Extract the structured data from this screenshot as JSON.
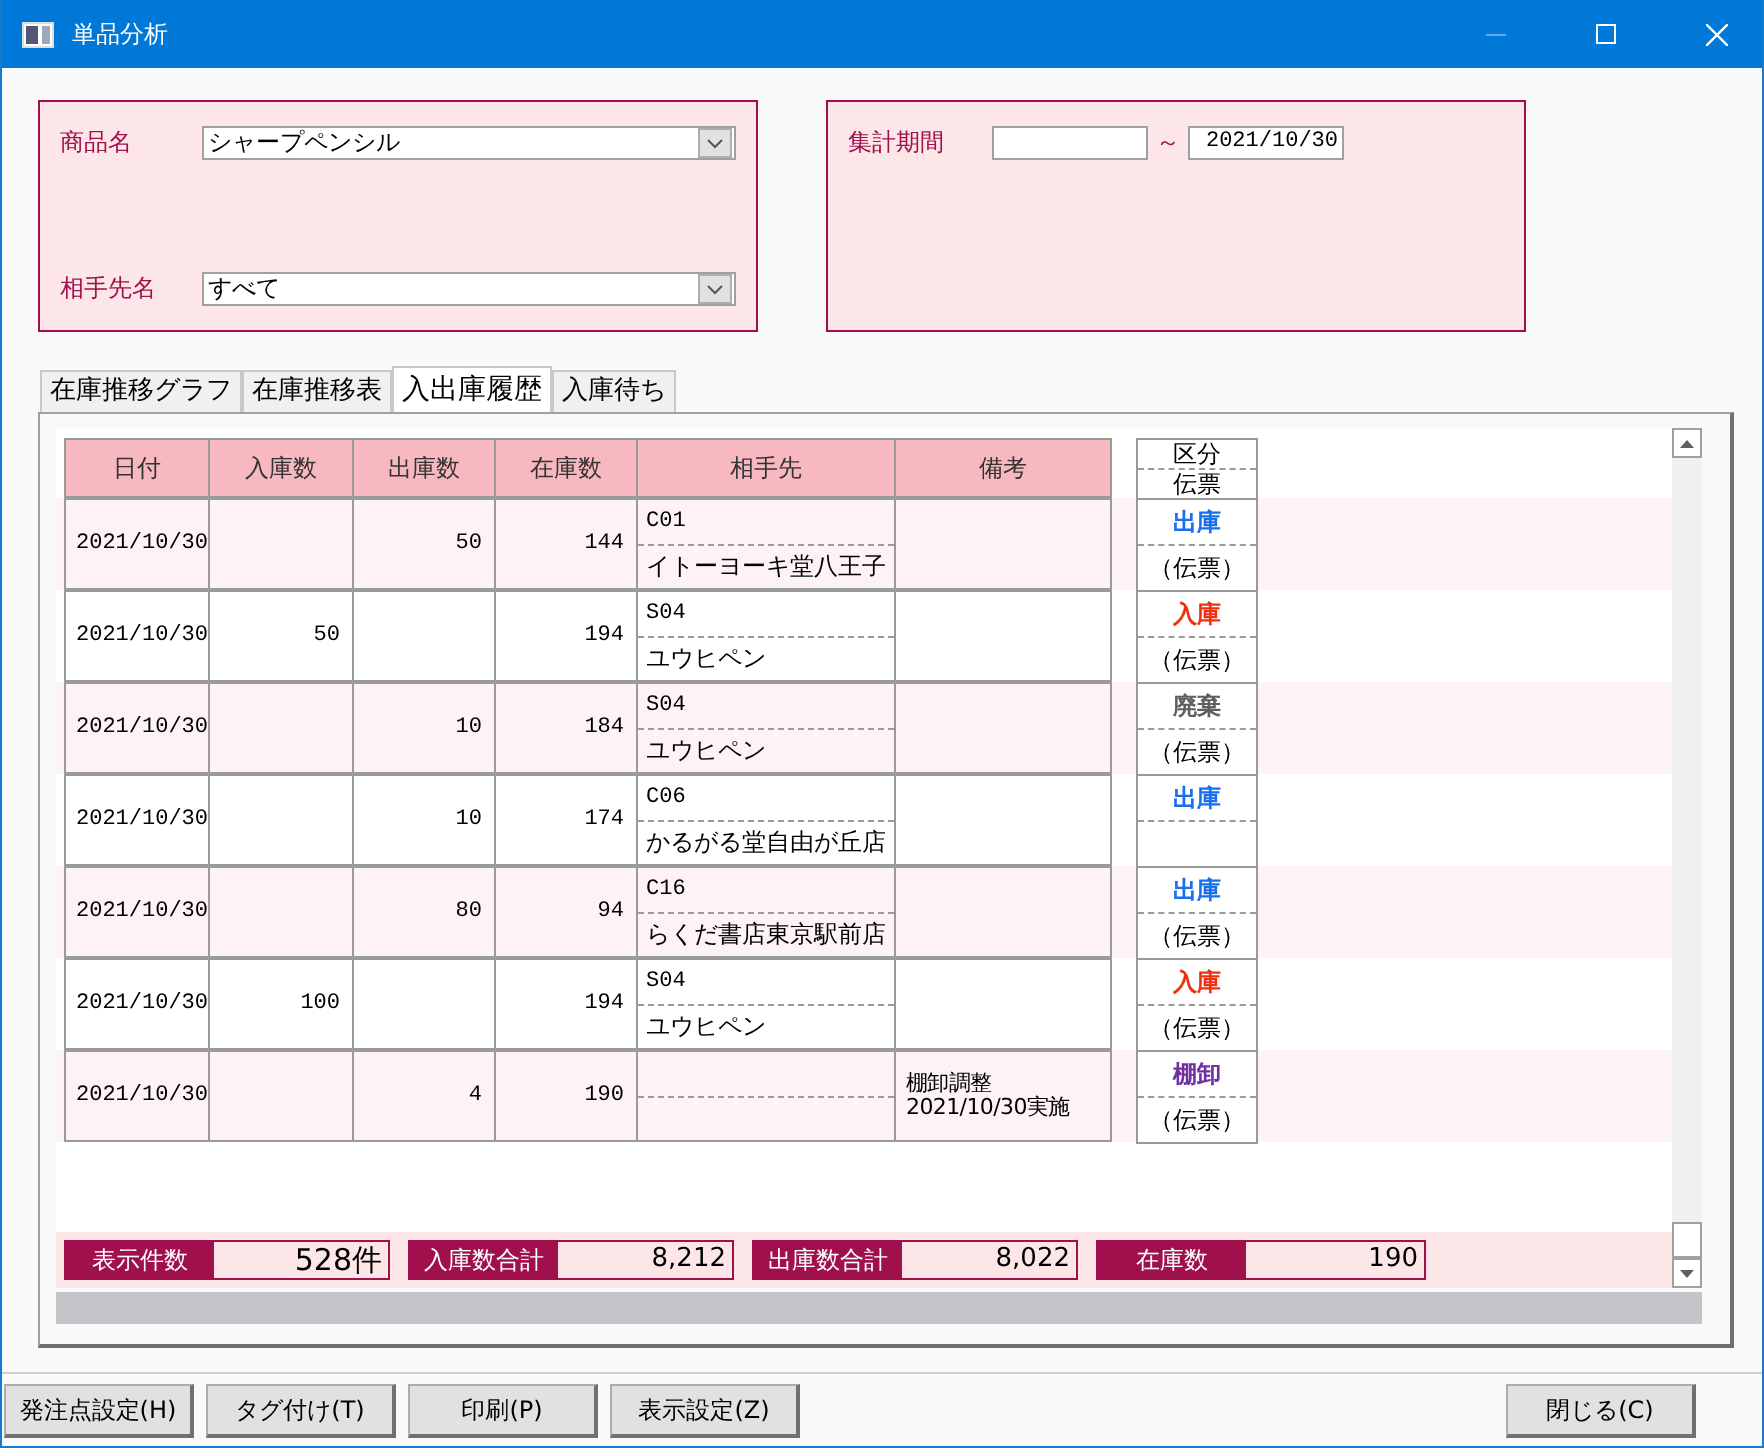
{
  "window": {
    "title": "単品分析"
  },
  "filters": {
    "product": {
      "label": "商品名",
      "value": "シャープペンシル"
    },
    "partner": {
      "label": "相手先名",
      "value": "すべて"
    },
    "period": {
      "label": "集計期間",
      "separator": "～",
      "to": "2021/10/30"
    }
  },
  "tabs": [
    {
      "label": "在庫推移グラフ",
      "selected": false
    },
    {
      "label": "在庫推移表",
      "selected": false
    },
    {
      "label": "入出庫履歴",
      "selected": true
    },
    {
      "label": "入庫待ち",
      "selected": false
    }
  ],
  "table": {
    "columns": [
      "日付",
      "入庫数",
      "出庫数",
      "在庫数",
      "相手先",
      "備考"
    ],
    "side_header": [
      "区分",
      "伝票"
    ],
    "rows": [
      {
        "date": "2021/10/30",
        "in": "",
        "out": "50",
        "stock": "144",
        "partner_code": "C01",
        "partner_name": "イトーヨーキ堂八王子",
        "note": "",
        "category": "出庫",
        "color": "#1a6ff0",
        "slip": "（伝票）"
      },
      {
        "date": "2021/10/30",
        "in": "50",
        "out": "",
        "stock": "194",
        "partner_code": "S04",
        "partner_name": "ユウヒペン",
        "note": "",
        "category": "入庫",
        "color": "#f03010",
        "slip": "（伝票）"
      },
      {
        "date": "2021/10/30",
        "in": "",
        "out": "10",
        "stock": "184",
        "partner_code": "S04",
        "partner_name": "ユウヒペン",
        "note": "",
        "category": "廃棄",
        "color": "#606060",
        "slip": "（伝票）"
      },
      {
        "date": "2021/10/30",
        "in": "",
        "out": "10",
        "stock": "174",
        "partner_code": "C06",
        "partner_name": "かるがる堂自由が丘店",
        "note": "",
        "category": "出庫",
        "color": "#1a6ff0",
        "slip": ""
      },
      {
        "date": "2021/10/30",
        "in": "",
        "out": "80",
        "stock": "94",
        "partner_code": "C16",
        "partner_name": "らくだ書店東京駅前店",
        "note": "",
        "category": "出庫",
        "color": "#1a6ff0",
        "slip": "（伝票）"
      },
      {
        "date": "2021/10/30",
        "in": "100",
        "out": "",
        "stock": "194",
        "partner_code": "S04",
        "partner_name": "ユウヒペン",
        "note": "",
        "category": "入庫",
        "color": "#f03010",
        "slip": "（伝票）"
      },
      {
        "date": "2021/10/30",
        "in": "",
        "out": "4",
        "stock": "190",
        "partner_code": "",
        "partner_name": "",
        "note": "棚卸調整\n2021/10/30実施",
        "category": "棚卸",
        "color": "#7030a0",
        "slip": "（伝票）"
      }
    ]
  },
  "summary": [
    {
      "label": "表示件数",
      "value": "528件"
    },
    {
      "label": "入庫数合計",
      "value": "8,212"
    },
    {
      "label": "出庫数合計",
      "value": "8,022"
    },
    {
      "label": "在庫数",
      "value": "190"
    }
  ],
  "buttons": [
    "発注点設定(H)",
    "タグ付け(T)",
    "印刷(P)",
    "表示設定(Z)"
  ],
  "close_button": "閉じる(C)"
}
